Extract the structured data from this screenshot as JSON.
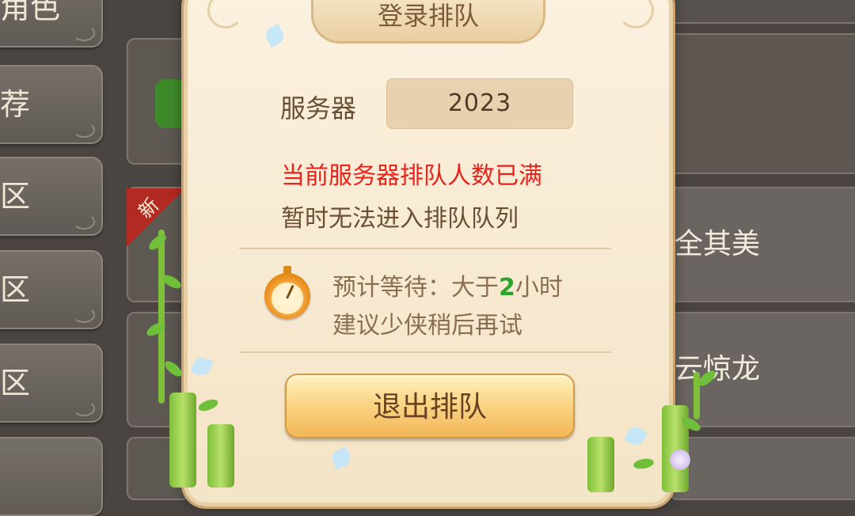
{
  "sidebar": {
    "items": [
      {
        "label": "角色"
      },
      {
        "label": "荐"
      },
      {
        "label": "区"
      },
      {
        "label": "区"
      },
      {
        "label": "区"
      },
      {
        "label": ""
      }
    ]
  },
  "list": {
    "badge_new": "新",
    "right_items": [
      "全其美",
      "云惊龙"
    ]
  },
  "dialog": {
    "title": "登录排队",
    "server_label": "服务器",
    "server_value": "2023",
    "message_full": "当前服务器排队人数已满",
    "message_unable": "暂时无法进入排队队列",
    "wait_prefix": "预计等待：大于",
    "wait_hours": "2",
    "wait_suffix": "小时",
    "advice": "建议少侠稍后再试",
    "exit_button": "退出排队"
  },
  "colors": {
    "warning": "#e8231b",
    "highlight_number": "#2aa52a"
  }
}
